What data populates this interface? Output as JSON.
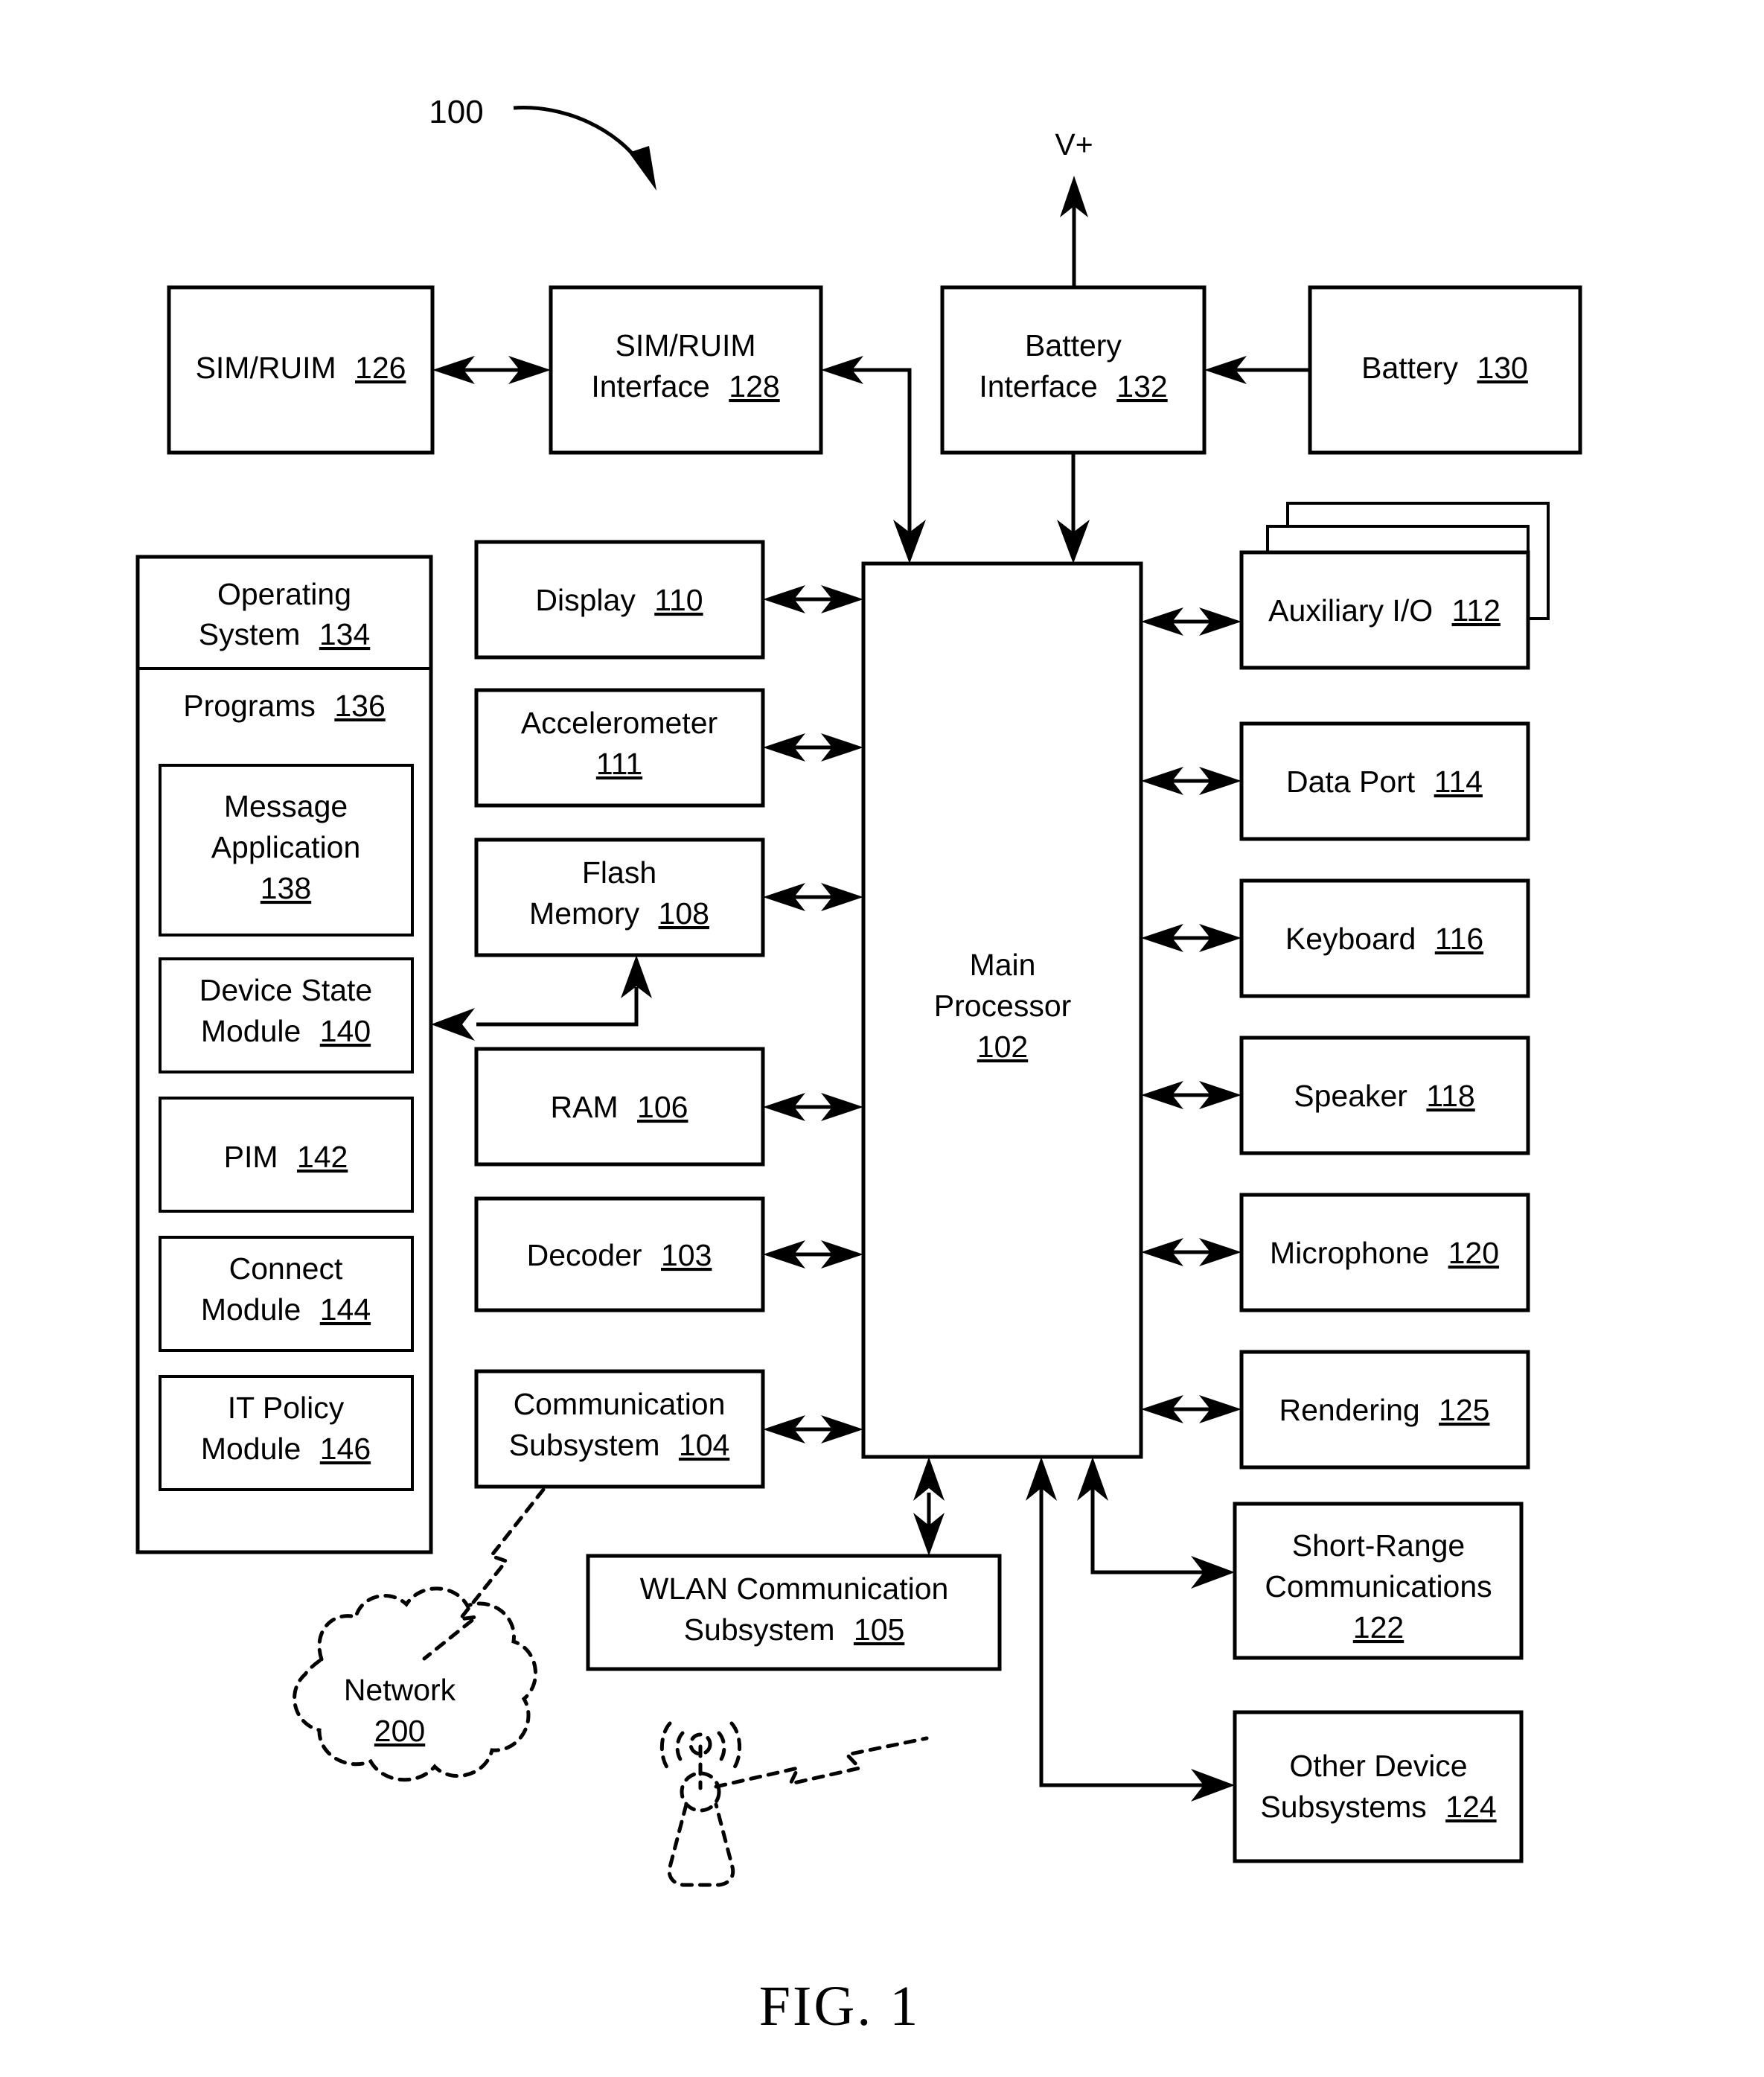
{
  "figure": {
    "caption": "FIG. 1",
    "reference_numeral": "100",
    "power_label": "V+"
  },
  "blocks": {
    "sim_ruim": {
      "line1": "SIM/RUIM",
      "num": "126"
    },
    "sim_ruim_interface": {
      "line1": "SIM/RUIM",
      "line2": "Interface",
      "num": "128"
    },
    "battery_interface": {
      "line1": "Battery",
      "line2": "Interface",
      "num": "132"
    },
    "battery": {
      "line1": "Battery",
      "num": "130"
    },
    "operating_system": {
      "line1": "Operating",
      "line2": "System",
      "num": "134"
    },
    "programs": {
      "line1": "Programs",
      "num": "136"
    },
    "message_application": {
      "line1": "Message",
      "line2": "Application",
      "num": "138"
    },
    "device_state_module": {
      "line1": "Device State",
      "line2": "Module",
      "num": "140"
    },
    "pim": {
      "line1": "PIM",
      "num": "142"
    },
    "connect_module": {
      "line1": "Connect",
      "line2": "Module",
      "num": "144"
    },
    "it_policy_module": {
      "line1": "IT Policy",
      "line2": "Module",
      "num": "146"
    },
    "display": {
      "line1": "Display",
      "num": "110"
    },
    "accelerometer": {
      "line1": "Accelerometer",
      "num": "111"
    },
    "flash_memory": {
      "line1": "Flash",
      "line2": "Memory",
      "num": "108"
    },
    "ram": {
      "line1": "RAM",
      "num": "106"
    },
    "decoder": {
      "line1": "Decoder",
      "num": "103"
    },
    "communication_subsystem": {
      "line1": "Communication",
      "line2": "Subsystem",
      "num": "104"
    },
    "main_processor": {
      "line1": "Main",
      "line2": "Processor",
      "num": "102"
    },
    "auxiliary_io": {
      "line1": "Auxiliary I/O",
      "num": "112"
    },
    "data_port": {
      "line1": "Data Port",
      "num": "114"
    },
    "keyboard": {
      "line1": "Keyboard",
      "num": "116"
    },
    "speaker": {
      "line1": "Speaker",
      "num": "118"
    },
    "microphone": {
      "line1": "Microphone",
      "num": "120"
    },
    "rendering": {
      "line1": "Rendering",
      "num": "125"
    },
    "short_range_communications": {
      "line1": "Short-Range",
      "line2": "Communications",
      "num": "122"
    },
    "other_device_subsystems": {
      "line1": "Other Device",
      "line2": "Subsystems",
      "num": "124"
    },
    "wlan_communication_subsystem": {
      "line1": "WLAN Communication",
      "line2": "Subsystem",
      "num": "105"
    },
    "network": {
      "line1": "Network",
      "num": "200"
    }
  }
}
